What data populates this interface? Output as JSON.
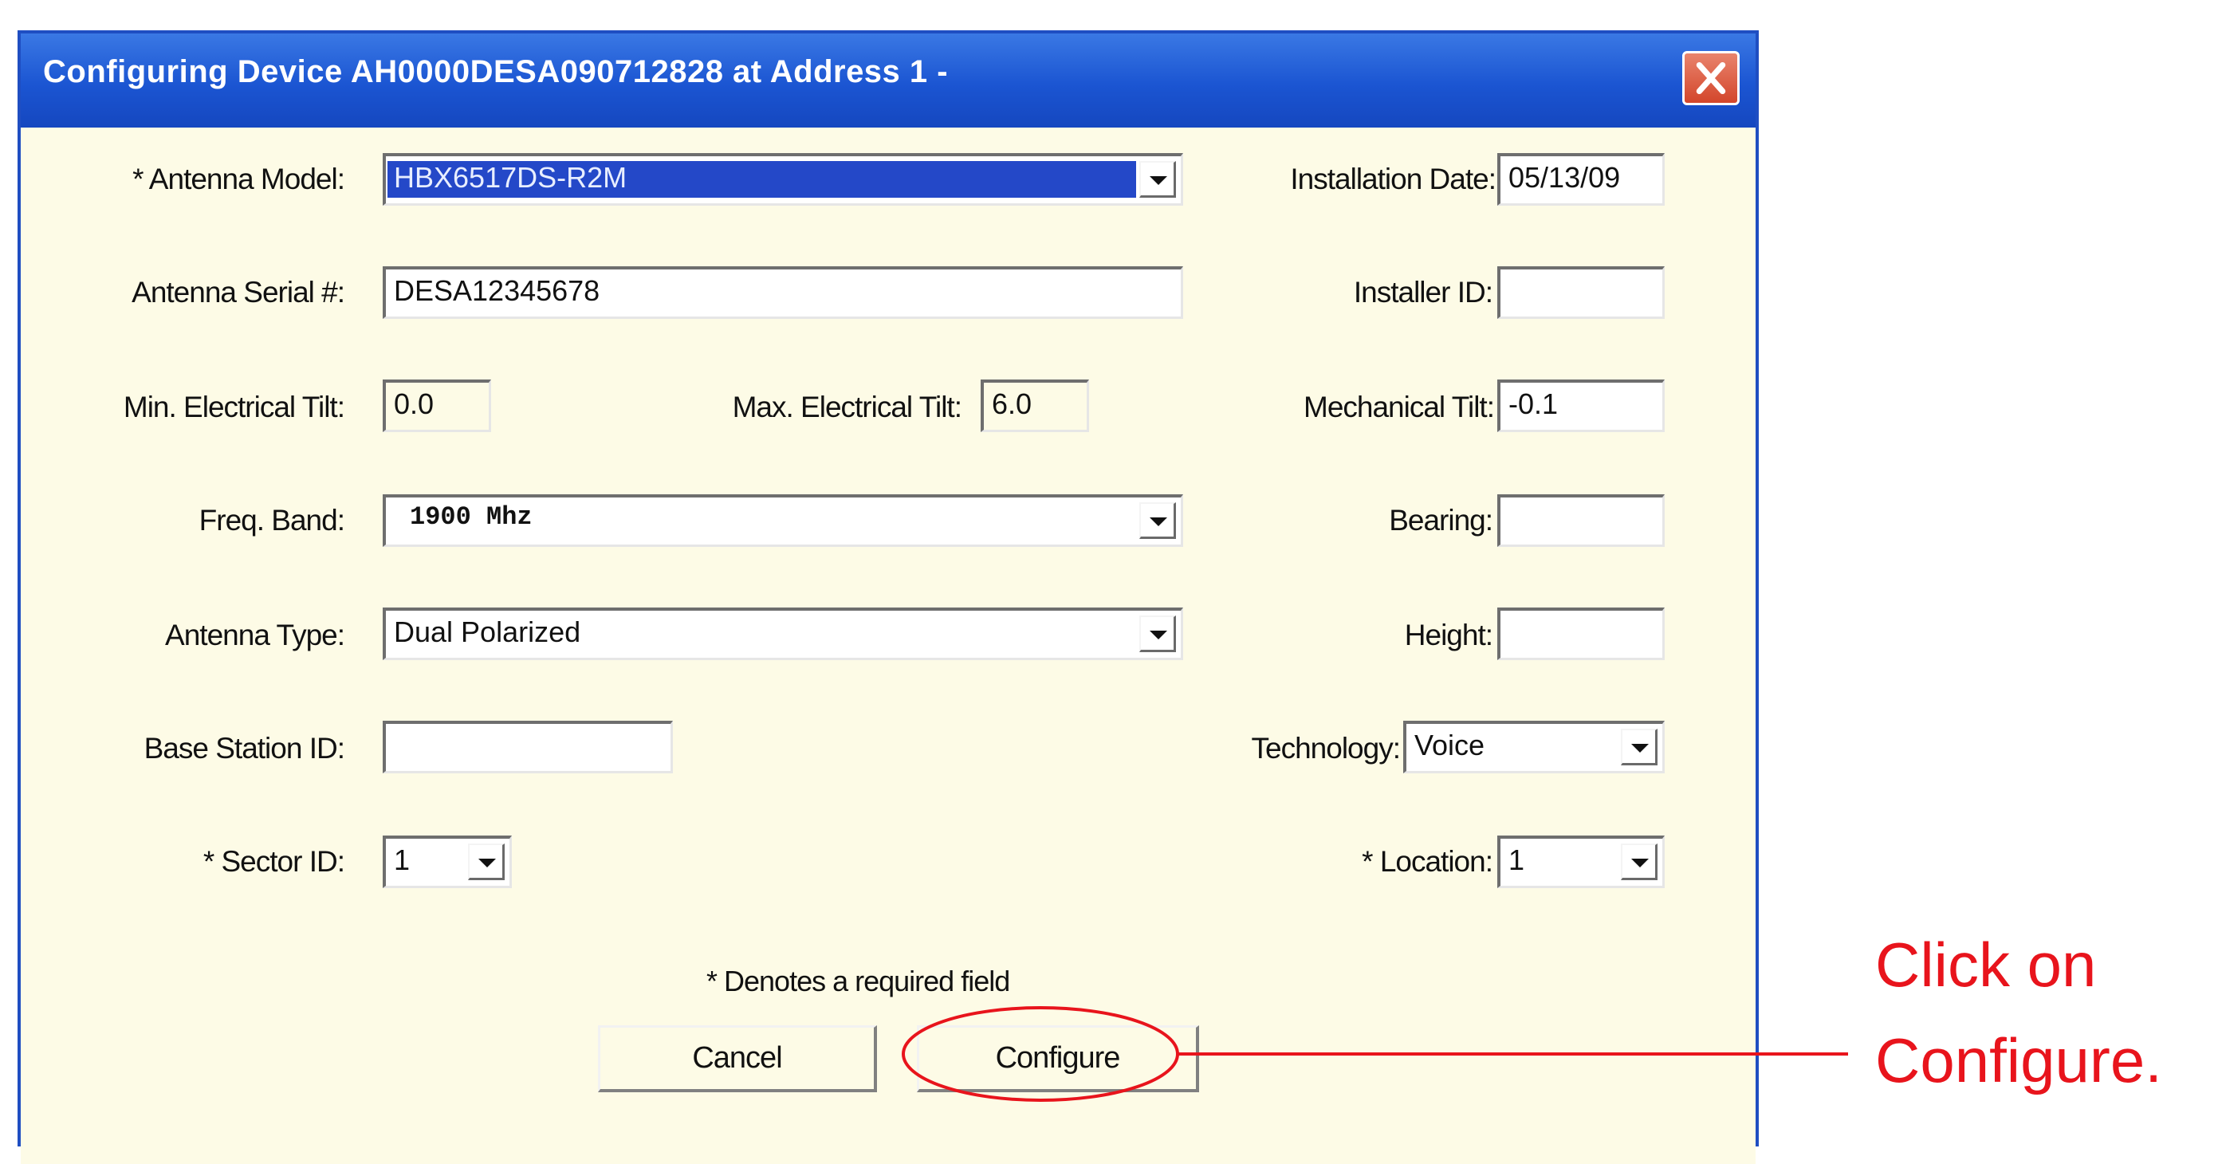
{
  "window": {
    "title": "Configuring Device AH0000DESA090712828 at Address 1 -",
    "close_icon": "close-x-icon",
    "accent_color": "#1b55d2",
    "close_color": "#d3462b"
  },
  "form": {
    "antenna_model": {
      "label": "* Antenna Model:",
      "value": "HBX6517DS-R2M"
    },
    "antenna_serial": {
      "label": "Antenna Serial #:",
      "value": "DESA12345678"
    },
    "min_tilt": {
      "label": "Min. Electrical Tilt:",
      "value": "0.0"
    },
    "max_tilt": {
      "label": "Max. Electrical Tilt:",
      "value": "6.0"
    },
    "freq_band": {
      "label": "Freq. Band:",
      "value": "1900 Mhz"
    },
    "antenna_type": {
      "label": "Antenna Type:",
      "value": "Dual Polarized"
    },
    "base_station": {
      "label": "Base Station ID:",
      "value": ""
    },
    "sector_id": {
      "label": "* Sector ID:",
      "value": "1"
    },
    "installation_date": {
      "label": "Installation Date:",
      "value": "05/13/09"
    },
    "installer_id": {
      "label": "Installer ID:",
      "value": ""
    },
    "mechanical_tilt": {
      "label": "Mechanical Tilt:",
      "value": "-0.1"
    },
    "bearing": {
      "label": "Bearing:",
      "value": ""
    },
    "height": {
      "label": "Height:",
      "value": ""
    },
    "technology": {
      "label": "Technology:",
      "value": "Voice"
    },
    "location": {
      "label": "* Location:",
      "value": "1"
    }
  },
  "footer": {
    "note": "* Denotes a required field",
    "cancel_label": "Cancel",
    "configure_label": "Configure"
  },
  "callout": {
    "line1": "Click on",
    "line2": "Configure.",
    "color": "#e8141c"
  }
}
